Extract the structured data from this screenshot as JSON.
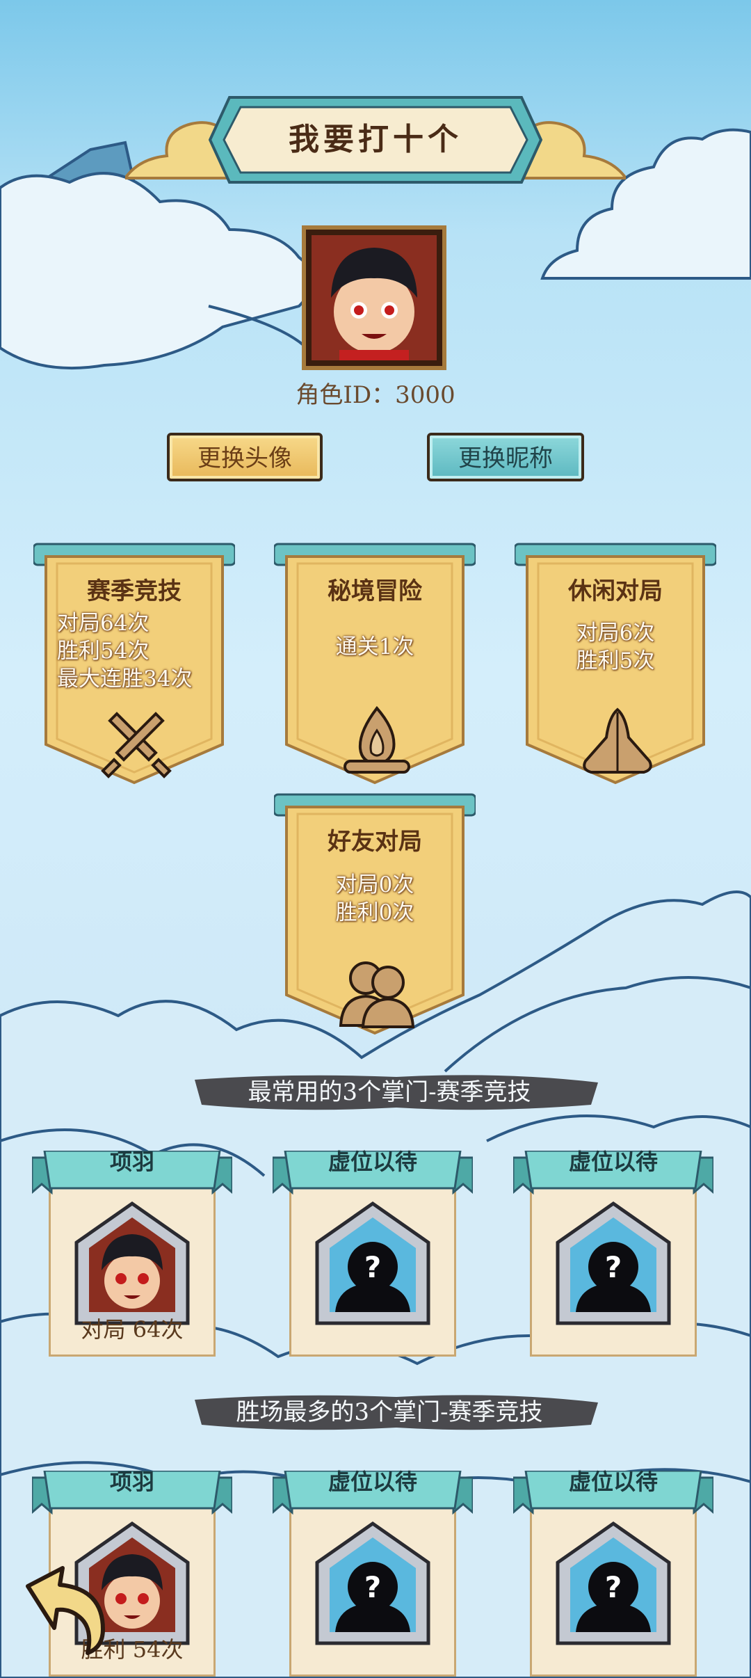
{
  "title": "我要打十个",
  "profile": {
    "role_id_label": "角色ID：3000",
    "change_avatar_label": "更换头像",
    "change_nickname_label": "更换昵称"
  },
  "modes": [
    {
      "name": "赛季竞技",
      "lines": [
        "对局64次",
        "胜利54次",
        "最大连胜34次"
      ],
      "icon": "crossed-swords-icon"
    },
    {
      "name": "秘境冒险",
      "lines": [
        "通关1次"
      ],
      "icon": "campfire-icon"
    },
    {
      "name": "休闲对局",
      "lines": [
        "对局6次",
        "胜利5次"
      ],
      "icon": "clasped-hands-icon"
    },
    {
      "name": "好友对局",
      "lines": [
        "对局0次",
        "胜利0次"
      ],
      "icon": "friends-icon"
    }
  ],
  "most_used": {
    "heading": "最常用的3个掌门-赛季竞技",
    "cards": [
      {
        "name": "项羽",
        "stat": "对局 64次",
        "portrait": "hero-portrait"
      },
      {
        "name": "虚位以待",
        "stat": "",
        "portrait": "silhouette-question-icon"
      },
      {
        "name": "虚位以待",
        "stat": "",
        "portrait": "silhouette-question-icon"
      }
    ]
  },
  "most_wins": {
    "heading": "胜场最多的3个掌门-赛季竞技",
    "cards": [
      {
        "name": "项羽",
        "stat": "胜利 54次",
        "portrait": "hero-portrait"
      },
      {
        "name": "虚位以待",
        "stat": "",
        "portrait": "silhouette-question-icon"
      },
      {
        "name": "虚位以待",
        "stat": "",
        "portrait": "silhouette-question-icon"
      }
    ]
  },
  "colors": {
    "sky_top": "#7cc8ea",
    "banner_gold": "#f2cf7a",
    "ribbon_teal": "#7fd6d2",
    "text_brown": "#5a3214"
  }
}
